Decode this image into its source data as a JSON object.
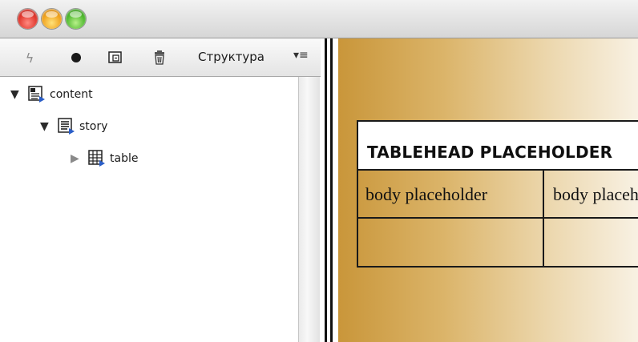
{
  "toolbar": {
    "icons": [
      "lightning-icon",
      "dot-icon",
      "new-element-icon",
      "trash-icon",
      "menu-icon"
    ],
    "panel_label": "Структура",
    "menu_glyph": "▾≡"
  },
  "tree": {
    "content_label": "content",
    "story_label": "story",
    "table_label": "table"
  },
  "table": {
    "head": "TABLEHEAD PLACEHOLDER",
    "row1": [
      "body placeholder",
      "body placeholder"
    ]
  },
  "colors": {
    "close": "#e0362c",
    "minimize": "#f0a21d",
    "maximize": "#4fb82f",
    "canvas_gradient_start": "#c9963a",
    "canvas_gradient_end": "#f8f1e3"
  }
}
